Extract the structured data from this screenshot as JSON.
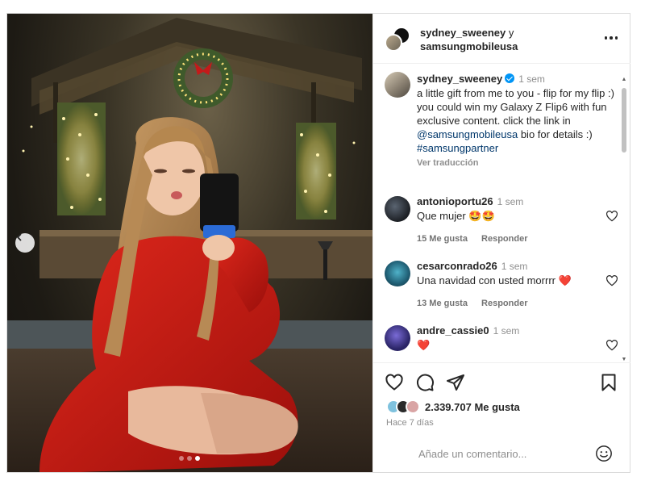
{
  "header": {
    "user1": "sydney_sweeney",
    "conjunction": "y",
    "user2": "samsungmobileusa",
    "more_icon": "more-horizontal-icon"
  },
  "caption": {
    "username": "sydney_sweeney",
    "time": "1 sem",
    "text_before_mention": "a little gift from me to you - flip for my flip :) you could win my Galaxy Z Flip6 with fun exclusive content. click the link in",
    "mention": "@samsungmobileusa",
    "text_after_mention": "bio for details :)",
    "hashtag": "#samsungpartner",
    "see_translation": "Ver traducción"
  },
  "comments": [
    {
      "username": "antonioportu26",
      "time": "1 sem",
      "text": "Que mujer 🤩🤩",
      "likes": "15 Me gusta",
      "reply": "Responder"
    },
    {
      "username": "cesarconrado26",
      "time": "1 sem",
      "text": "Una navidad con usted morrrr ❤️",
      "likes": "13 Me gusta",
      "reply": "Responder"
    },
    {
      "username": "andre_cassie0",
      "time": "1 sem",
      "text": "❤️"
    }
  ],
  "actions": {
    "likes": "2.339.707 Me gusta",
    "posted_ago": "Hace 7 días",
    "icons": [
      "heart-icon",
      "comment-icon",
      "share-icon",
      "bookmark-icon"
    ]
  },
  "add_comment": {
    "placeholder": "Añade un comentario...",
    "emoji_icon": "emoji-smile-icon"
  },
  "carousel": {
    "slides": 3,
    "active_index": 2
  },
  "colors": {
    "link": "#00376b",
    "verified": "#0095f6",
    "muted": "#8e8e8e",
    "heart": "#ed4956"
  }
}
